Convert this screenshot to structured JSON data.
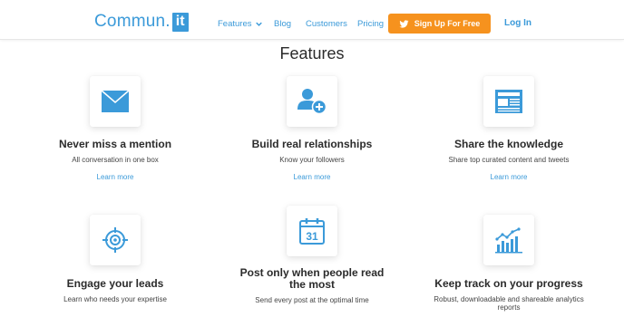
{
  "header": {
    "logo_text": "Commun.",
    "logo_box": "it",
    "nav": {
      "features": "Features",
      "blog": "Blog",
      "customers": "Customers",
      "pricing": "Pricing"
    },
    "signup_label": "Sign Up For Free",
    "login_label": "Log In"
  },
  "page_title": "Features",
  "features": [
    {
      "title": "Never miss a mention",
      "desc": "All conversation in one box",
      "link": "Learn more",
      "icon": "envelope-icon"
    },
    {
      "title": "Build real relationships",
      "desc": "Know your followers",
      "link": "Learn more",
      "icon": "add-user-icon"
    },
    {
      "title": "Share the knowledge",
      "desc": "Share top curated content and tweets",
      "link": "Learn more",
      "icon": "newspaper-icon"
    },
    {
      "title": "Engage your leads",
      "desc": "Learn who needs your expertise",
      "icon": "target-icon"
    },
    {
      "title": "Post only when people read the most",
      "desc": "Send every post at the optimal time",
      "icon": "calendar-icon"
    },
    {
      "title": "Keep track on your progress",
      "desc": "Robust, downloadable and shareable analytics reports",
      "icon": "analytics-chart-icon"
    }
  ],
  "calendar_day": "31",
  "colors": {
    "brand": "#3b9ad9",
    "cta": "#f6921e"
  }
}
